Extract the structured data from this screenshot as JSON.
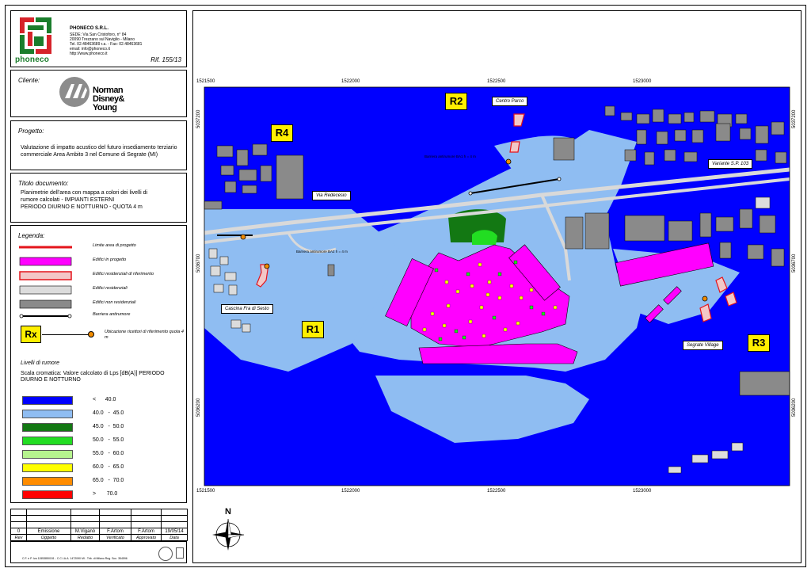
{
  "company": {
    "logo_text": "phoneco",
    "name": "PHONECO S.R.L.",
    "lines": [
      "SEDE: Via San Cristoforo, n° 84",
      "20090 Trezzano sul Naviglio - Milano",
      "Tel. 02.48463689 r.a. - Fax: 02.48463681",
      "email: info@phoneco.it",
      "http://www.phoneco.it"
    ],
    "reference": "Rif. 155/13"
  },
  "client": {
    "label": "Cliente:",
    "name_lines": [
      "Norman",
      "Disney&",
      "Young"
    ]
  },
  "project": {
    "label": "Progetto:",
    "description": "Valutazione di impatto acustico del futuro insediamento terziario commerciale Area Ambito 3 nel Comune di Segrate (MI)"
  },
  "document": {
    "label": "Titolo documento:",
    "description_lines": [
      "Planimetrie dell'area con mappa a colori dei livelli di",
      "rumore calcolati - IMPIANTI ESTERNI",
      "PERIODO DIURNO E NOTTURNO - QUOTA 4 m"
    ]
  },
  "legend": {
    "label": "Legenda:",
    "items": [
      {
        "symbol": "line-red",
        "text": "Limite area di progetto"
      },
      {
        "symbol": "fill-magenta",
        "text": "Edifici in progetto"
      },
      {
        "symbol": "fill-pink-red",
        "text": "Edifici residenziali di riferimento"
      },
      {
        "symbol": "fill-lightgrey",
        "text": "Edifici residenziali"
      },
      {
        "symbol": "fill-darkgrey",
        "text": "Edifici non residenziali"
      },
      {
        "symbol": "barrier",
        "text": "Barriera antirumore"
      }
    ],
    "receiver_badge": "Rx",
    "receiver_text": "Ubicazione ricettori di riferimento quota 4 m",
    "noise_title": "Livelli di rumore",
    "scale_caption": "Scala cromatica: Valore calcolato di Lps [dB(A)] PERIODO DIURNO E NOTTURNO",
    "scale": [
      {
        "range": "<      40.0",
        "color": "#0000ff"
      },
      {
        "range": "40.0   -  45.0",
        "color": "#8fbdf2"
      },
      {
        "range": "45.0   -  50.0",
        "color": "#137813"
      },
      {
        "range": "50.0   -  55.0",
        "color": "#22dd22"
      },
      {
        "range": "55.0   -  60.0",
        "color": "#b6f48e"
      },
      {
        "range": "60.0   -  65.0",
        "color": "#ffff00"
      },
      {
        "range": "65.0   -  70.0",
        "color": "#ff8c00"
      },
      {
        "range": ">       70.0",
        "color": "#ff0000"
      }
    ]
  },
  "revision": {
    "rows": [
      [
        "",
        "",
        "",
        "",
        "",
        ""
      ],
      [
        "",
        "",
        "",
        "",
        "",
        ""
      ],
      [
        "",
        "",
        "",
        "",
        "",
        ""
      ],
      [
        "0",
        "Emissione",
        "M.Viganò",
        "F.Artom",
        "F.Artom",
        "19/05/14"
      ]
    ],
    "headers": [
      "Rev",
      "Oggetto",
      "Redatto",
      "Verificato",
      "Approvato",
      "Data"
    ]
  },
  "footer": {
    "text": "C.F. e P. Iva 11553850151 - C.C.I.A.A. 1472090 MI - Trib. di Milano Reg. Soc. 354596"
  },
  "map": {
    "coords_x": [
      "1521500",
      "1522000",
      "1522500",
      "1523000"
    ],
    "coords_y": [
      "5037200",
      "5036700",
      "5036200"
    ],
    "receivers": [
      "R1",
      "R2",
      "R3",
      "R4"
    ],
    "labels": {
      "centro_parco": "Centro Parco",
      "variante": "Variante S.P. 103",
      "via_redecesio": "Via Redecesio",
      "cascina": "Cascina Fra di Sesto",
      "segrate_village": "Segrate Village"
    },
    "road_notes": {
      "barrier_1": "Barriera antirumore BA1 h = 4 m",
      "barrier_2": "Barriera antirumore BA2 h = 4 m"
    },
    "north_label": "N",
    "colors": {
      "below_40": "#0000ff",
      "range_40_45": "#8fbdf2",
      "range_45_50": "#137813",
      "range_50_55": "#22dd22",
      "range_55_60": "#b6f48e",
      "project_buildings": "#ff00ff"
    }
  }
}
